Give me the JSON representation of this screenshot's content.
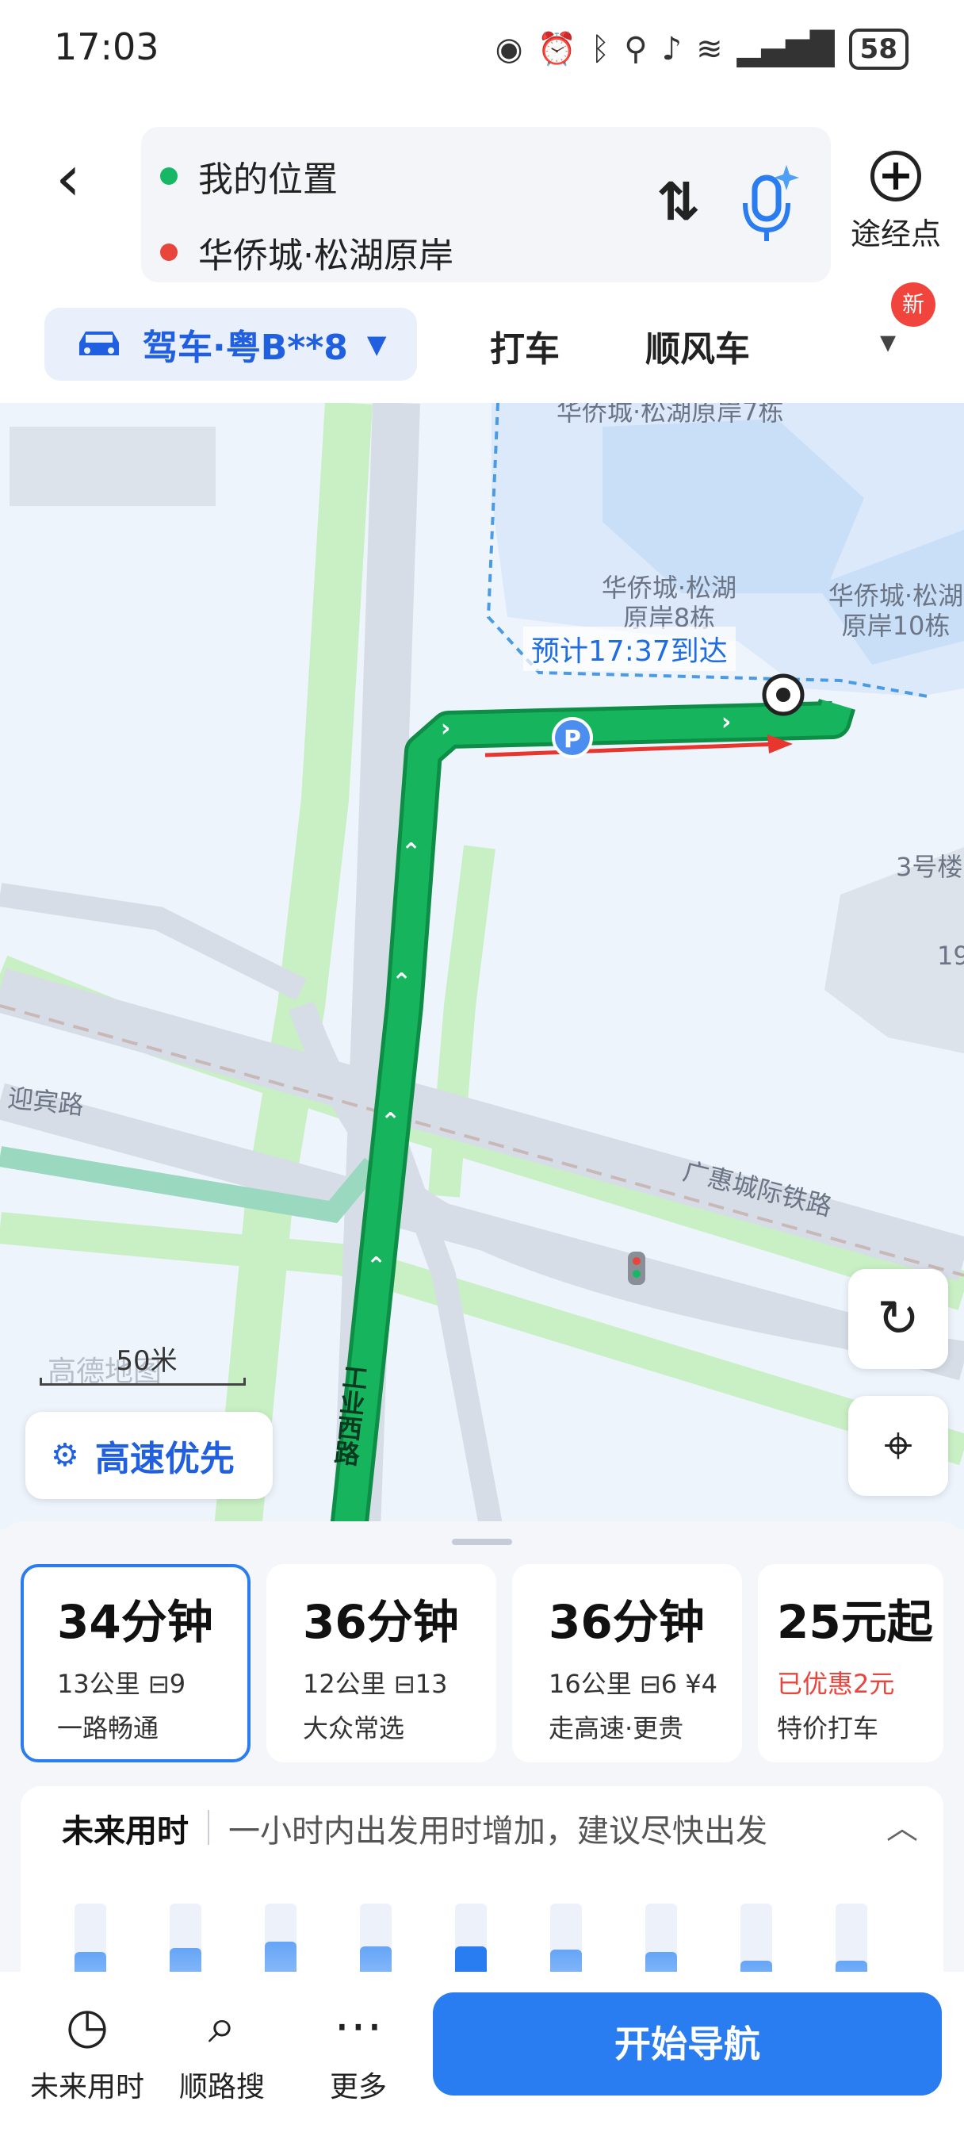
{
  "status_bar": {
    "time": "17:03",
    "battery": "58"
  },
  "search": {
    "origin": "我的位置",
    "destination": "华侨城·松湖原岸",
    "waypoint_label": "途经点"
  },
  "modes": {
    "drive": "驾车·粤B**8",
    "taxi": "打车",
    "carpool": "顺风车",
    "new_badge": "新"
  },
  "map": {
    "labels": [
      "华侨城·松湖原岸7栋",
      "华侨城·松湖原岸8栋",
      "华侨城·松湖原岸10栋",
      "3号楼",
      "19"
    ],
    "eta": "预计17:37到达",
    "roads": [
      "迎宾路",
      "广惠城际铁路",
      "工业西路"
    ],
    "scale": "50米",
    "watermark": "高德地图",
    "highway_pref": "高速优先"
  },
  "routes": [
    {
      "time": "34分钟",
      "detail": "13公里 ⊟9",
      "note": "一路畅通",
      "selected": true
    },
    {
      "time": "36分钟",
      "detail": "12公里 ⊟13",
      "note": "大众常选",
      "selected": false
    },
    {
      "time": "36分钟",
      "detail": "16公里 ⊟6 ¥4",
      "note": "走高速·更贵",
      "selected": false
    },
    {
      "time": "25元起",
      "detail": "已优惠2元",
      "note": "特价打车",
      "selected": false
    }
  ],
  "future": {
    "title": "未来用时",
    "desc": "一小时内出发用时增加，建议尽快出发",
    "bars": [
      0.62,
      0.65,
      0.7,
      0.66,
      0.66,
      0.64,
      0.62,
      0.55,
      0.55
    ],
    "peak_index": 4
  },
  "bottom_nav": {
    "future_time": "未来用时",
    "along_search": "顺路搜",
    "more": "更多",
    "start": "开始导航"
  },
  "colors": {
    "accent": "#2a7cf1",
    "route_green": "#13b35c",
    "origin_dot": "#16b866",
    "dest_dot": "#e8453c"
  }
}
